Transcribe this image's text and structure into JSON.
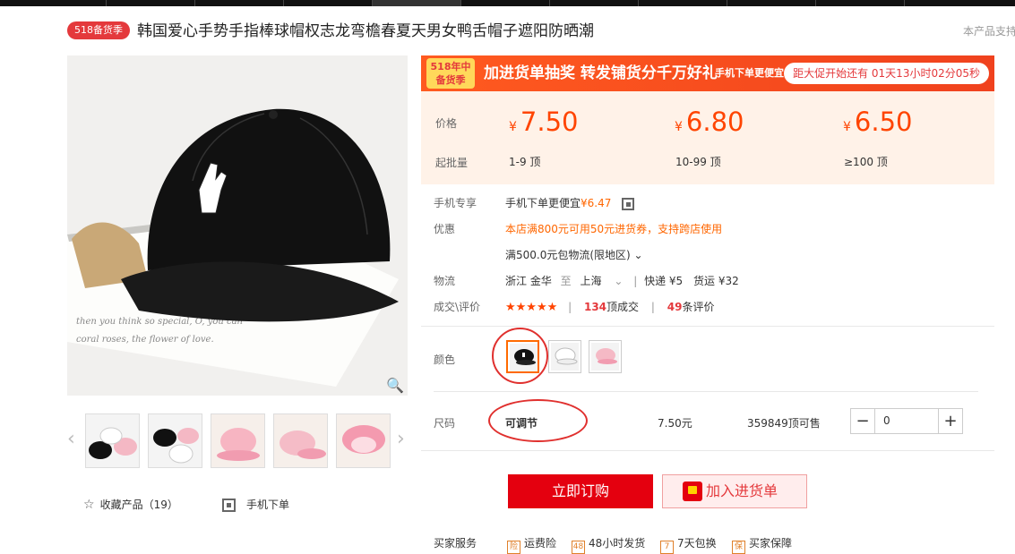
{
  "header": {
    "badge": "518备货季",
    "title": "韩国爱心手势手指棒球帽权志龙弯檐春夏天男女鸭舌帽子遮阳防晒潮",
    "support_text": "本产品支持"
  },
  "promo": {
    "tag_line1": "518年中",
    "tag_line2": "备货季",
    "headline": "加进货单抽奖 转发铺货分千万好礼",
    "mobile_text": "手机下单更便宜",
    "countdown": "距大促开始还有 01天13小时02分05秒"
  },
  "pricing": {
    "price_label": "价格",
    "batch_label": "起批量",
    "currency": "¥",
    "tiers": [
      {
        "price": "7.50",
        "range": "1-9 顶"
      },
      {
        "price": "6.80",
        "range": "10-99 顶"
      },
      {
        "price": "6.50",
        "range": "≥100 顶"
      }
    ]
  },
  "info": {
    "mobile_label": "手机专享",
    "mobile_text": "手机下单更便宜",
    "mobile_price": "¥6.47",
    "discount_label": "优惠",
    "discount_text": "本店满800元可用50元进货券，支持跨店使用",
    "free_shipping": "满500.0元包物流(限地区)",
    "logistics_label": "物流",
    "from": "浙江 金华",
    "to_word": "至",
    "to": "上海",
    "express": "快递 ¥5",
    "freight": "货运 ¥32",
    "deals_label": "成交\\评价",
    "stars": "★★★★★",
    "deal_count": "134",
    "deal_suffix": "顶成交",
    "review_count": "49",
    "review_suffix": "条评价"
  },
  "options": {
    "color_label": "颜色",
    "size_label": "尺码",
    "size_value": "可调节",
    "size_price": "7.50元",
    "stock": "359849顶可售",
    "quantity": "0"
  },
  "actions": {
    "buy": "立即订购",
    "cart": "加入进货单"
  },
  "left": {
    "fav": "收藏产品（19）",
    "mobile_order": "手机下单"
  },
  "services": {
    "label": "买家服务",
    "items": [
      "运费险",
      "48小时发货",
      "7天包换",
      "买家保障"
    ]
  }
}
